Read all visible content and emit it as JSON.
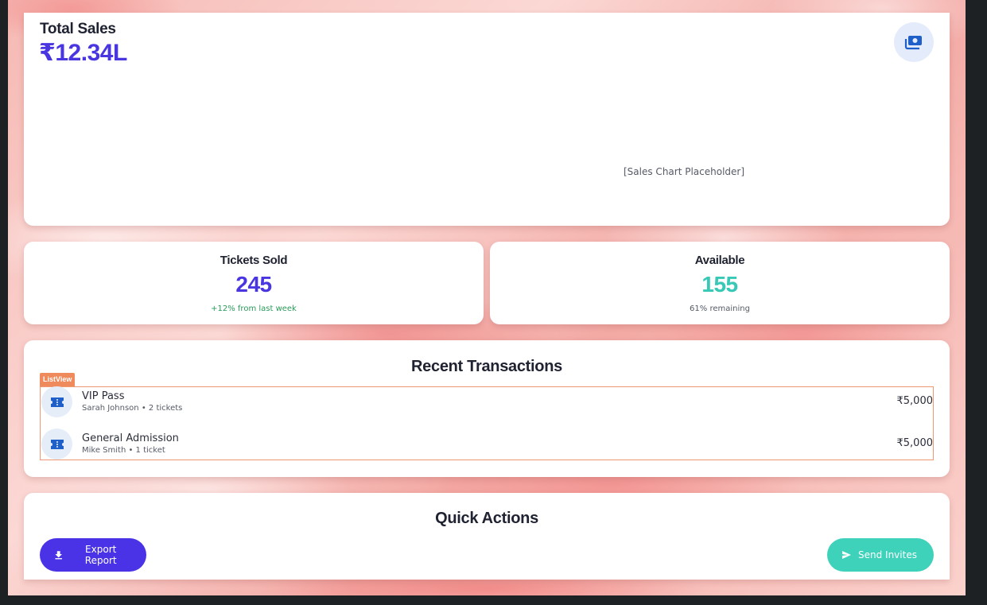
{
  "sales": {
    "title": "Total Sales",
    "value": "₹12.34L",
    "icon": "cash-icon",
    "chart_placeholder": "[Sales Chart Placeholder]"
  },
  "stats": {
    "tickets_sold": {
      "label": "Tickets Sold",
      "value": "245",
      "sub": "+12% from last week"
    },
    "available": {
      "label": "Available",
      "value": "155",
      "sub": "61% remaining"
    }
  },
  "transactions": {
    "title": "Recent Transactions",
    "listview_tag": "ListView",
    "items": [
      {
        "name": "VIP Pass",
        "meta": "Sarah Johnson • 2 tickets",
        "amount": "₹5,000",
        "icon": "ticket-icon"
      },
      {
        "name": "General Admission",
        "meta": "Mike Smith • 1 ticket",
        "amount": "₹5,000",
        "icon": "ticket-icon"
      }
    ]
  },
  "quick_actions": {
    "title": "Quick Actions",
    "export_label": "Export Report",
    "invite_label": "Send Invites"
  },
  "colors": {
    "primary": "#4a32e6",
    "accent": "#3ed2bb",
    "value_purple": "#4936e0",
    "positive_green": "#2a9a5a",
    "teal": "#38c9b6",
    "icon_blue": "#1f5fc9",
    "listview_orange": "#ee8a5c"
  }
}
